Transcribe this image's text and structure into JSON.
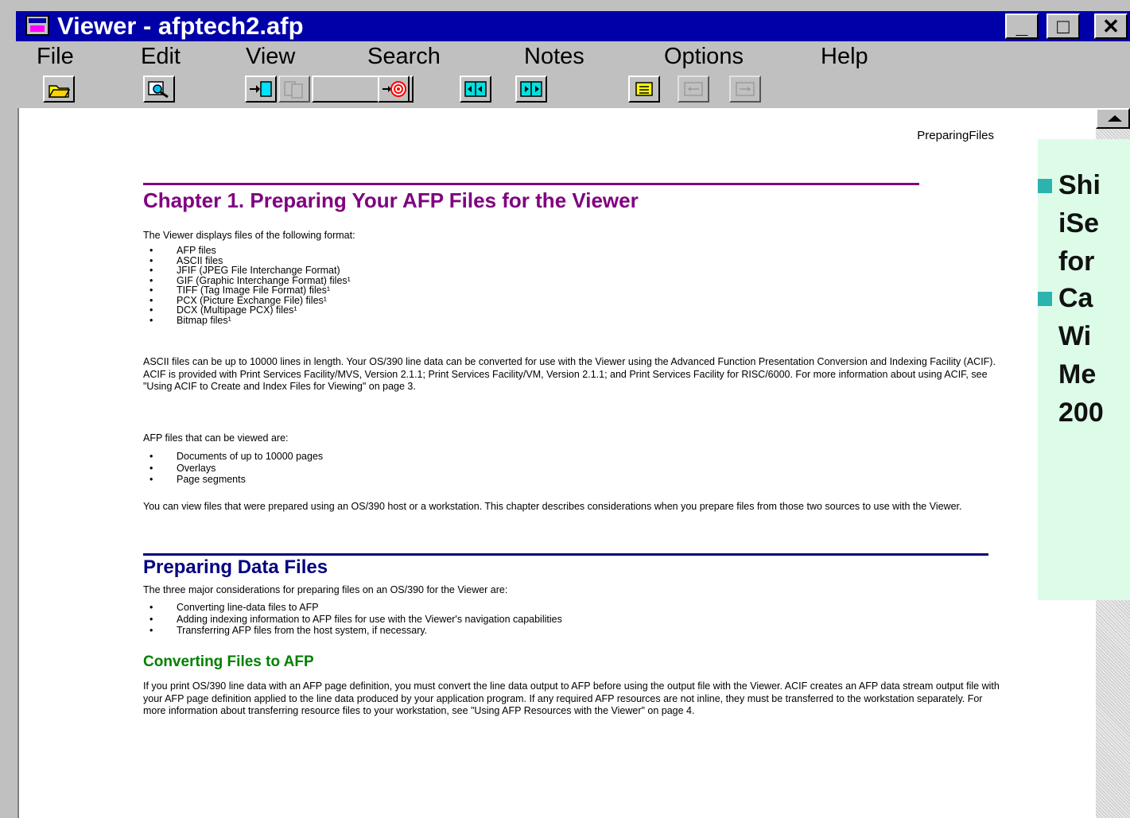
{
  "window": {
    "title": "Viewer - afptech2.afp",
    "min_glyph": "_",
    "max_glyph": "□",
    "close_glyph": "✕"
  },
  "menu": [
    "File",
    "Edit",
    "View",
    "Search",
    "Notes",
    "Options",
    "Help"
  ],
  "toolbar": {
    "buttons": [
      {
        "icon": "open-folder-icon",
        "enabled": true
      },
      {
        "icon": "find-icon",
        "enabled": true
      },
      {
        "icon": "go-to-page-icon",
        "enabled": true
      },
      {
        "icon": "copy-pages-icon",
        "enabled": false
      },
      {
        "icon": "target-icon",
        "enabled": true
      },
      {
        "icon": "previous-page-icon",
        "enabled": true
      },
      {
        "icon": "next-page-icon",
        "enabled": true
      },
      {
        "icon": "note-icon",
        "enabled": true
      },
      {
        "icon": "previous-note-icon",
        "enabled": false
      },
      {
        "icon": "next-note-icon",
        "enabled": false
      }
    ]
  },
  "document": {
    "running_head": "PreparingFiles",
    "chapter_title": "Chapter 1.  Preparing Your AFP Files for the Viewer",
    "intro": "The Viewer displays files of the following format:",
    "formats": [
      "AFP files",
      "ASCII files",
      "JFIF (JPEG File Interchange Format)",
      "GIF (Graphic Interchange Format) files¹",
      "TIFF (Tag Image File Format) files¹",
      "PCX (Picture Exchange File) files¹",
      "DCX (Multipage PCX) files¹",
      "Bitmap files¹"
    ],
    "ascii_para": "ASCII files can be up to 10000 lines in length.  Your OS/390 line data can be converted for use with the Viewer using the Advanced Function Presentation Conversion and Indexing Facility (ACIF).  ACIF is provided with Print Services Facility/MVS, Version 2.1.1; Print Services Facility/VM, Version 2.1.1; and Print Services Facility for RISC/6000.  For more information about using ACIF, see \"Using ACIF to Create and Index Files for Viewing\" on page 3.",
    "afp_intro": "AFP files that can be viewed are:",
    "afp_types": [
      "Documents of up to 10000 pages",
      "Overlays",
      "Page segments"
    ],
    "sources_para": "You can view files that were prepared using an OS/390 host or a workstation.  This chapter describes considerations when you prepare files from those two sources to use with the Viewer.",
    "section_title": "Preparing Data Files",
    "section_intro": "The three major considerations for preparing files on an OS/390 for the Viewer are:",
    "considerations": [
      "Converting line-data files to AFP",
      "Adding indexing information to AFP files for use with the Viewer's navigation capabilities",
      "Transferring AFP files from the host system, if necessary."
    ],
    "subsection_title": "Converting Files to AFP",
    "converting_para": "If you print OS/390 line data with an AFP page definition, you must convert the line data output to AFP before using the output file with the Viewer.  ACIF creates an AFP data stream output file with your AFP page definition applied to the line data produced by your application program.  If any required AFP resources are not inline, they must be transferred to the workstation separately.  For more information about transferring resource files to your workstation, see \"Using AFP Resources with the Viewer\" on page 4."
  },
  "callout": {
    "item1_lines": [
      "Shi",
      "iSe",
      "for"
    ],
    "item2_lines": [
      "Ca",
      "Wi",
      "Me",
      "200"
    ]
  },
  "colors": {
    "titlebar": "#0000a8",
    "chapter": "#800080",
    "section": "#000080",
    "subsection": "#008000",
    "callout_bg": "#dcfce8",
    "bullet": "#2bb3b0"
  }
}
